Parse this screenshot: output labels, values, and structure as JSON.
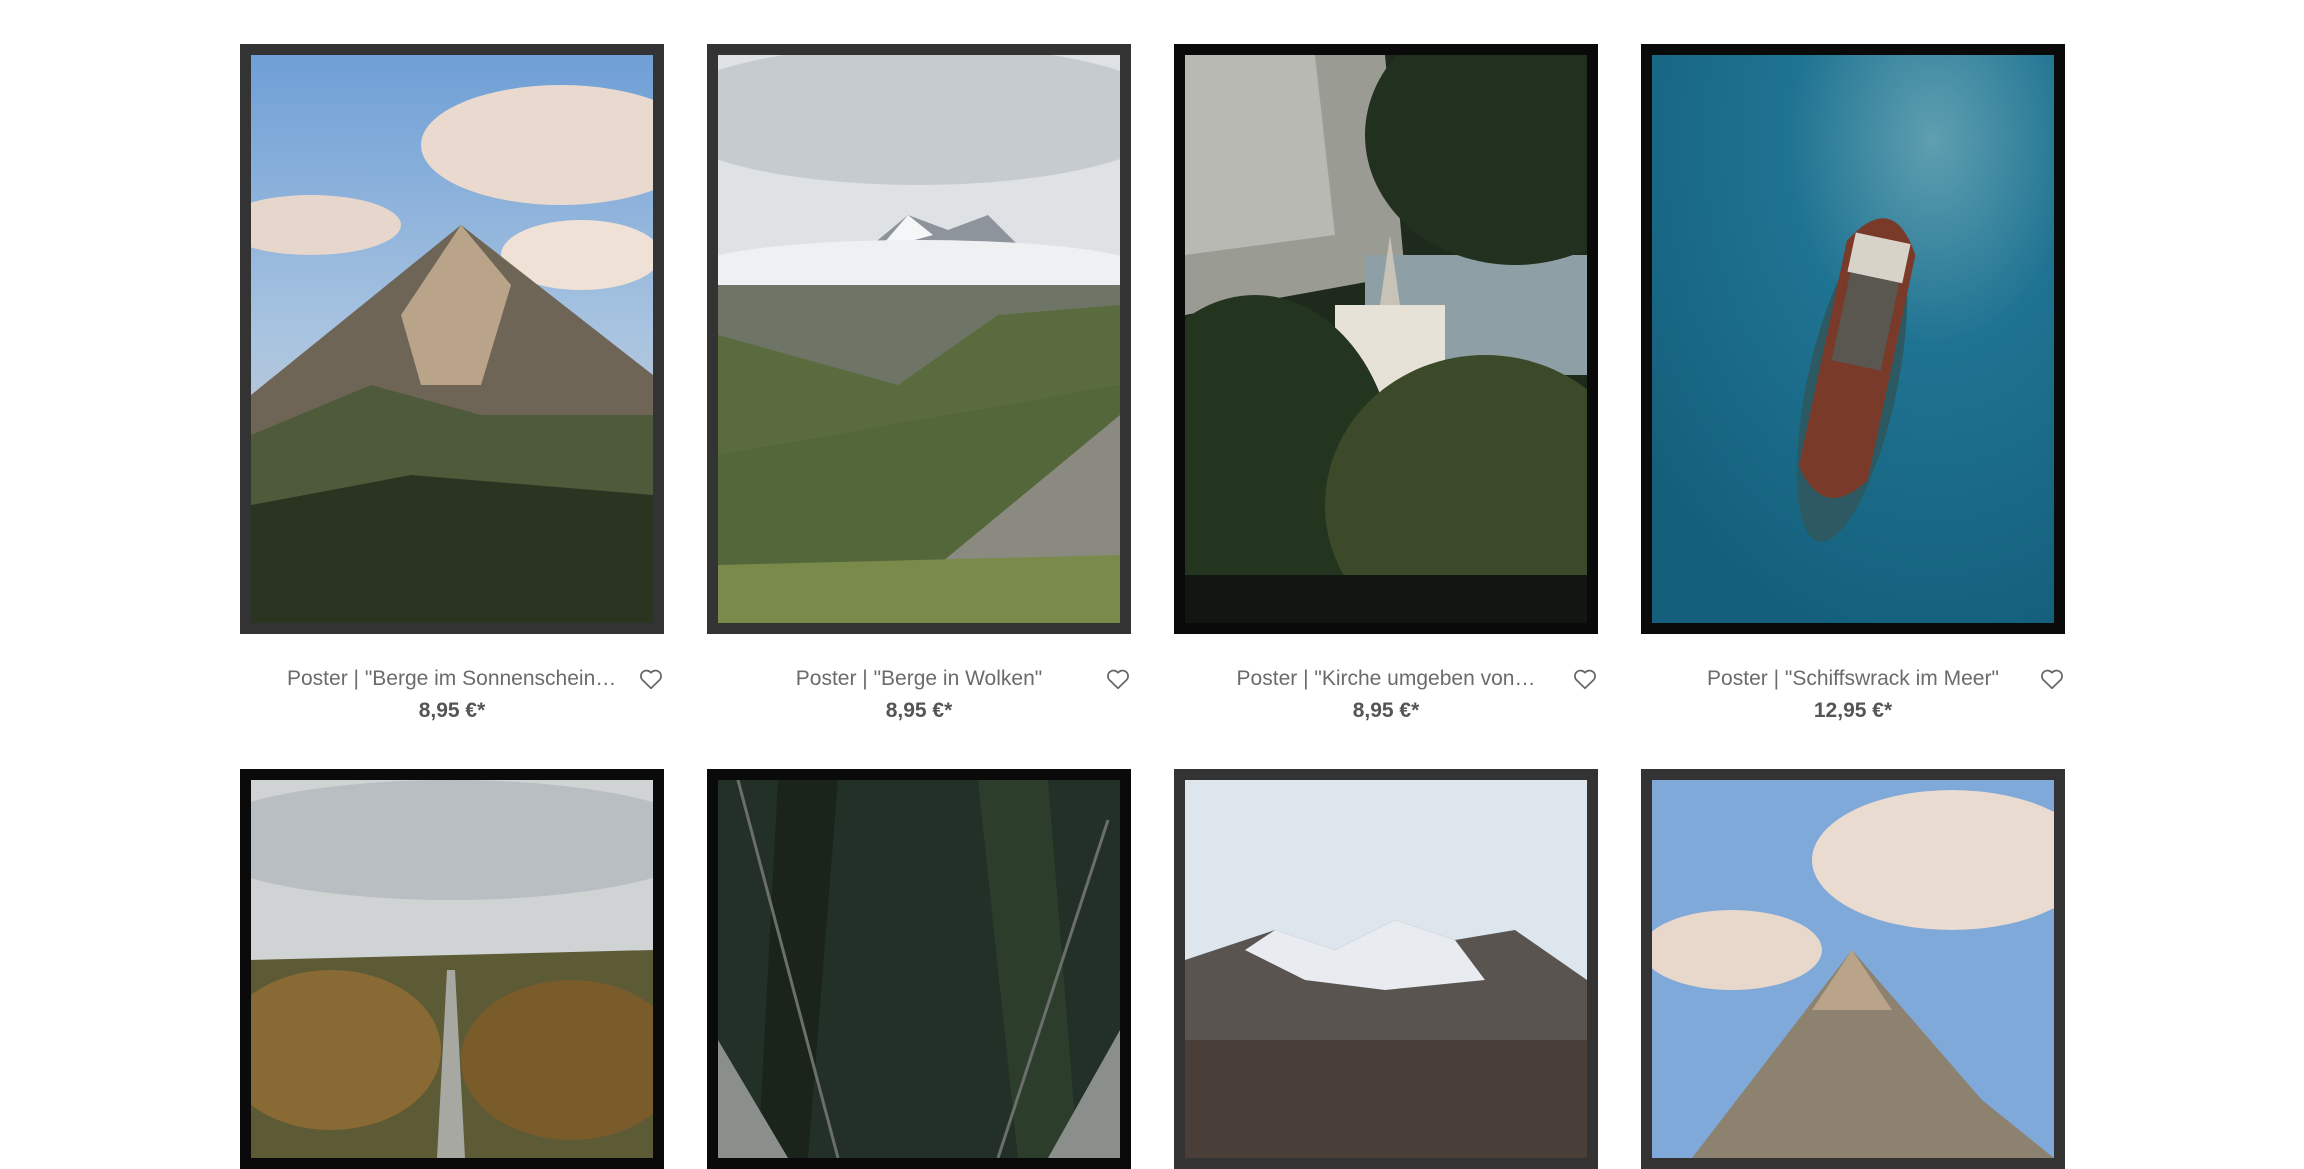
{
  "products": [
    {
      "title": "Poster | \"Berge im Sonnenschein mit…",
      "price": "8,95 €*"
    },
    {
      "title": "Poster | \"Berge in Wolken\"",
      "price": "8,95 €*"
    },
    {
      "title": "Poster | \"Kirche umgeben von…",
      "price": "8,95 €*"
    },
    {
      "title": "Poster | \"Schiffswrack im Meer\"",
      "price": "12,95 €*"
    }
  ],
  "icons": {
    "wishlist": "heart-outline-icon"
  },
  "colors": {
    "frame_grey": "#333333",
    "frame_black": "#0a0a0a",
    "text": "#6b6b6b",
    "price": "#555555"
  }
}
